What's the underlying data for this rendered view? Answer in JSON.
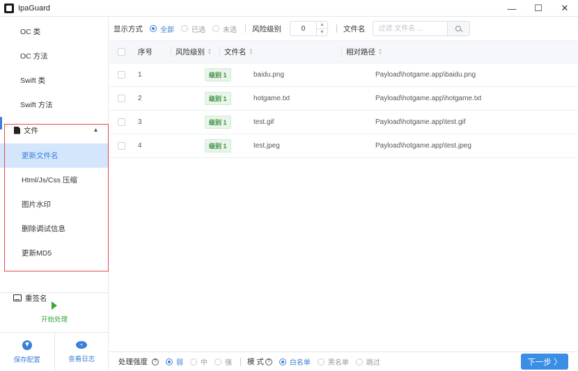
{
  "window": {
    "title": "IpaGuard",
    "controls": {
      "minimize": "—",
      "maximize": "☐",
      "close": "✕"
    }
  },
  "sidebar": {
    "items": [
      {
        "label": "OC 类"
      },
      {
        "label": "OC 方法"
      },
      {
        "label": "Swift 类"
      },
      {
        "label": "Swift 方法"
      }
    ],
    "group": {
      "label": "文件",
      "expanded": true,
      "subitems": [
        {
          "label": "更新文件名",
          "active": true
        },
        {
          "label": "Html/Js/Css 压缩",
          "active": false
        },
        {
          "label": "图片水印",
          "active": false
        },
        {
          "label": "删除调试信息",
          "active": false
        },
        {
          "label": "更新MD5",
          "active": false
        }
      ]
    },
    "resign_label": "重签名",
    "start_label": "开始处理",
    "save_label": "保存配置",
    "log_label": "查看日志",
    "highlight_color": "#e5464b",
    "accent_color": "#3a7fd8",
    "start_color": "#37a63a"
  },
  "toolbar": {
    "display_label": "显示方式",
    "display_options": [
      {
        "label": "全部",
        "checked": true
      },
      {
        "label": "已选",
        "checked": false
      },
      {
        "label": "未选",
        "checked": false
      }
    ],
    "risk_label": "风险级别",
    "risk_value": "0",
    "filename_label": "文件名",
    "search_placeholder": "过滤 文件名 ..."
  },
  "table": {
    "headers": {
      "index": "序号",
      "risk": "风险级别",
      "name": "文件名",
      "path": "相对路径"
    },
    "rows": [
      {
        "index": "1",
        "risk": "级别 1",
        "name": "baidu.png",
        "path": "Payload\\hotgame.app\\baidu.png"
      },
      {
        "index": "2",
        "risk": "级别 1",
        "name": "hotgame.txt",
        "path": "Payload\\hotgame.app\\hotgame.txt"
      },
      {
        "index": "3",
        "risk": "级别 1",
        "name": "test.gif",
        "path": "Payload\\hotgame.app\\test.gif"
      },
      {
        "index": "4",
        "risk": "级别 1",
        "name": "test.jpeg",
        "path": "Payload\\hotgame.app\\test.jpeg"
      }
    ]
  },
  "bottombar": {
    "strength_label": "处理强度",
    "strength_options": [
      {
        "label": "弱",
        "checked": true
      },
      {
        "label": "中",
        "checked": false
      },
      {
        "label": "强",
        "checked": false
      }
    ],
    "mode_label": "模 式",
    "mode_options": [
      {
        "label": "白名单",
        "checked": true
      },
      {
        "label": "黑名单",
        "checked": false
      },
      {
        "label": "跳过",
        "checked": false
      }
    ],
    "help_glyph": "?",
    "next_label": "下一步 〉"
  }
}
